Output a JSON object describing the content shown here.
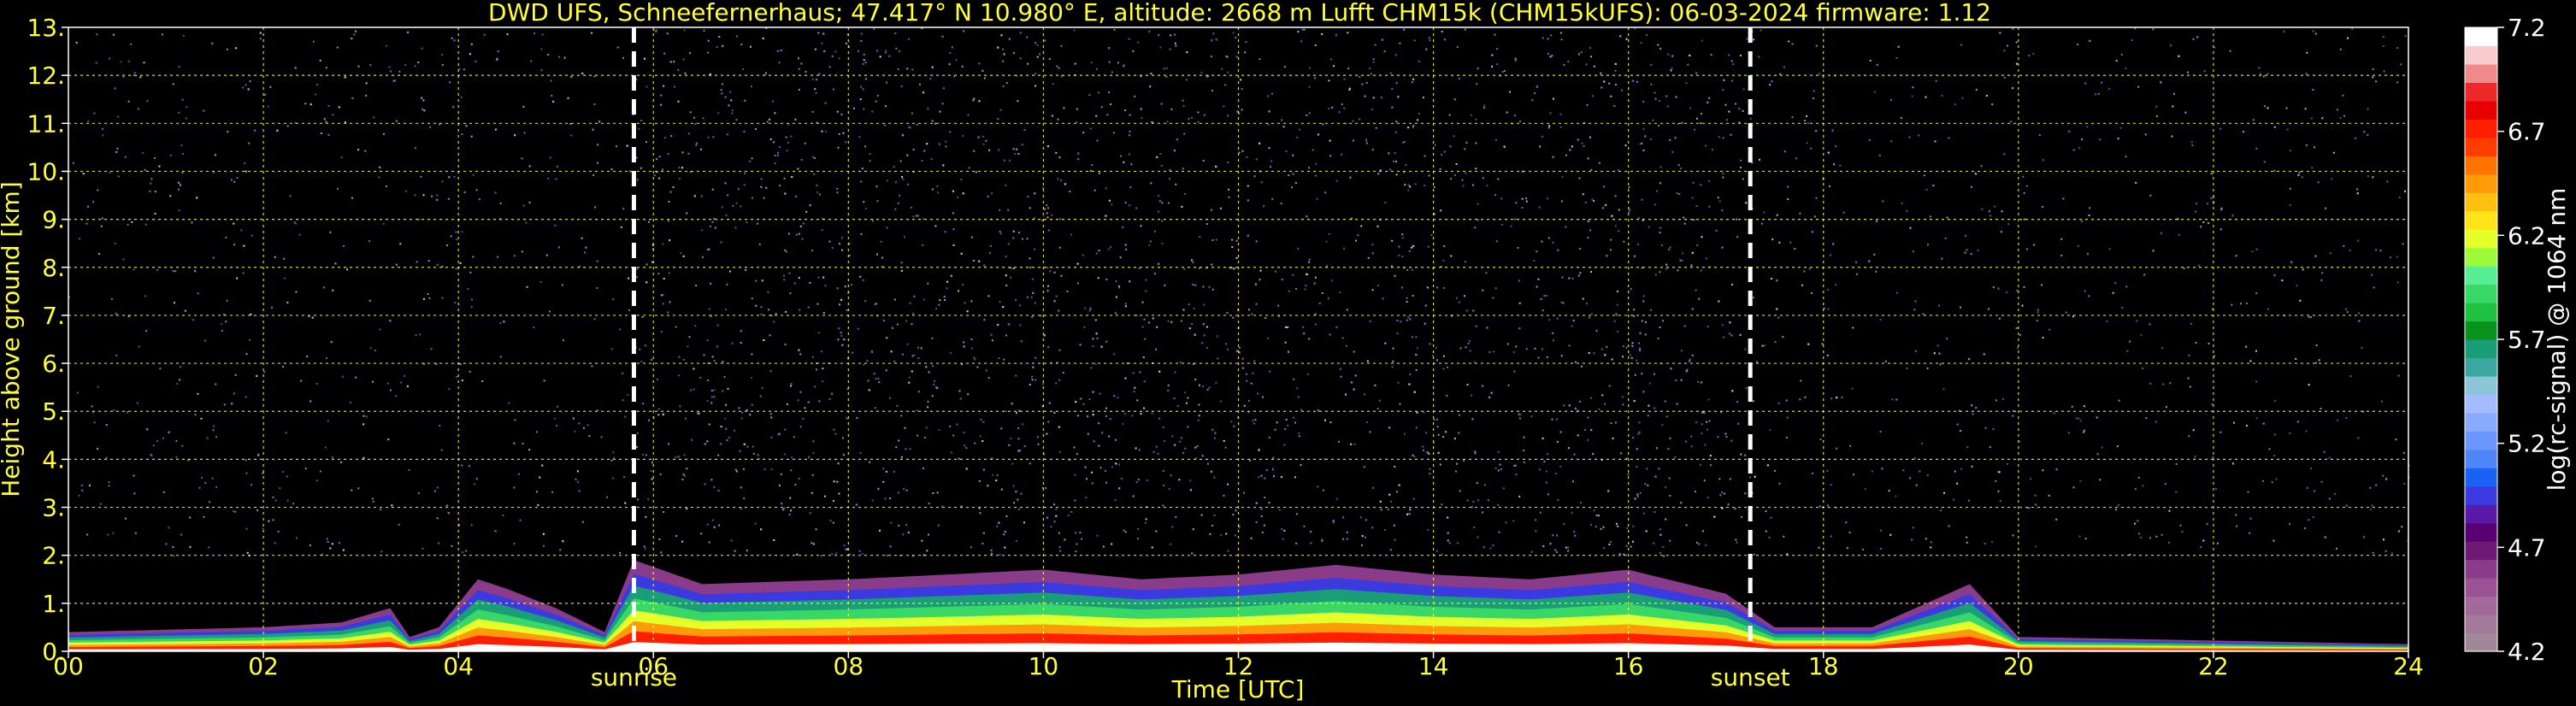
{
  "chart_data": {
    "type": "heatmap",
    "title": "DWD UFS, Schneefernerhaus; 47.417° N 10.980° E, altitude: 2668 m    Lufft CHM15k (CHM15kUFS): 06-03-2024    firmware: 1.12",
    "xlabel": "Time [UTC]",
    "ylabel": "Height above ground [km]",
    "xlim": [
      0,
      24
    ],
    "ylim": [
      0,
      13
    ],
    "x_ticks": [
      "00",
      "02",
      "04",
      "06",
      "08",
      "10",
      "12",
      "14",
      "16",
      "18",
      "20",
      "22",
      "24"
    ],
    "y_ticks": [
      "0.",
      "1.",
      "2.",
      "3.",
      "4.",
      "5.",
      "6.",
      "7.",
      "8.",
      "9.",
      "10.",
      "11.",
      "12.",
      "13."
    ],
    "grid": true,
    "annotations": [
      {
        "label": "sunrise",
        "x": 5.8
      },
      {
        "label": "sunset",
        "x": 17.25
      }
    ],
    "colorbar": {
      "label": "log(rc-signal) @ 1064 nm",
      "range": [
        4.2,
        7.2
      ],
      "ticks": [
        "4.2",
        "4.7",
        "5.2",
        "5.7",
        "6.2",
        "6.7",
        "7.2"
      ],
      "colors": [
        "#a08898",
        "#a47a9a",
        "#a2699a",
        "#9a5294",
        "#8a3c8a",
        "#6e1a74",
        "#580072",
        "#5a18aa",
        "#3a3ae0",
        "#1a62f6",
        "#4e86fa",
        "#6c96ff",
        "#88aaff",
        "#a4bcff",
        "#8ac6d8",
        "#3aa8a0",
        "#1a9e78",
        "#08921e",
        "#20c040",
        "#38d868",
        "#56ee90",
        "#9cfa3a",
        "#e4ff2a",
        "#ffe41a",
        "#ffc010",
        "#ff9a08",
        "#ff7400",
        "#ff3c00",
        "#ff1e00",
        "#e80000",
        "#ec2828",
        "#f08a8a",
        "#f8cccc",
        "#ffffff"
      ]
    },
    "boundary_layer": [
      {
        "t": 0.0,
        "top": 0.4
      },
      {
        "t": 1.0,
        "top": 0.45
      },
      {
        "t": 2.0,
        "top": 0.5
      },
      {
        "t": 2.8,
        "top": 0.6
      },
      {
        "t": 3.3,
        "top": 0.9
      },
      {
        "t": 3.5,
        "top": 0.3
      },
      {
        "t": 3.8,
        "top": 0.5
      },
      {
        "t": 4.2,
        "top": 1.5
      },
      {
        "t": 4.5,
        "top": 1.3
      },
      {
        "t": 5.0,
        "top": 0.9
      },
      {
        "t": 5.5,
        "top": 0.4
      },
      {
        "t": 5.8,
        "top": 1.9
      },
      {
        "t": 6.5,
        "top": 1.4
      },
      {
        "t": 8.0,
        "top": 1.5
      },
      {
        "t": 9.0,
        "top": 1.6
      },
      {
        "t": 10.0,
        "top": 1.7
      },
      {
        "t": 11.0,
        "top": 1.5
      },
      {
        "t": 12.0,
        "top": 1.6
      },
      {
        "t": 13.0,
        "top": 1.8
      },
      {
        "t": 14.0,
        "top": 1.6
      },
      {
        "t": 15.0,
        "top": 1.5
      },
      {
        "t": 16.0,
        "top": 1.7
      },
      {
        "t": 17.0,
        "top": 1.2
      },
      {
        "t": 17.5,
        "top": 0.5
      },
      {
        "t": 18.5,
        "top": 0.5
      },
      {
        "t": 19.5,
        "top": 1.4
      },
      {
        "t": 20.0,
        "top": 0.3
      },
      {
        "t": 24.0,
        "top": 0.15
      }
    ]
  }
}
